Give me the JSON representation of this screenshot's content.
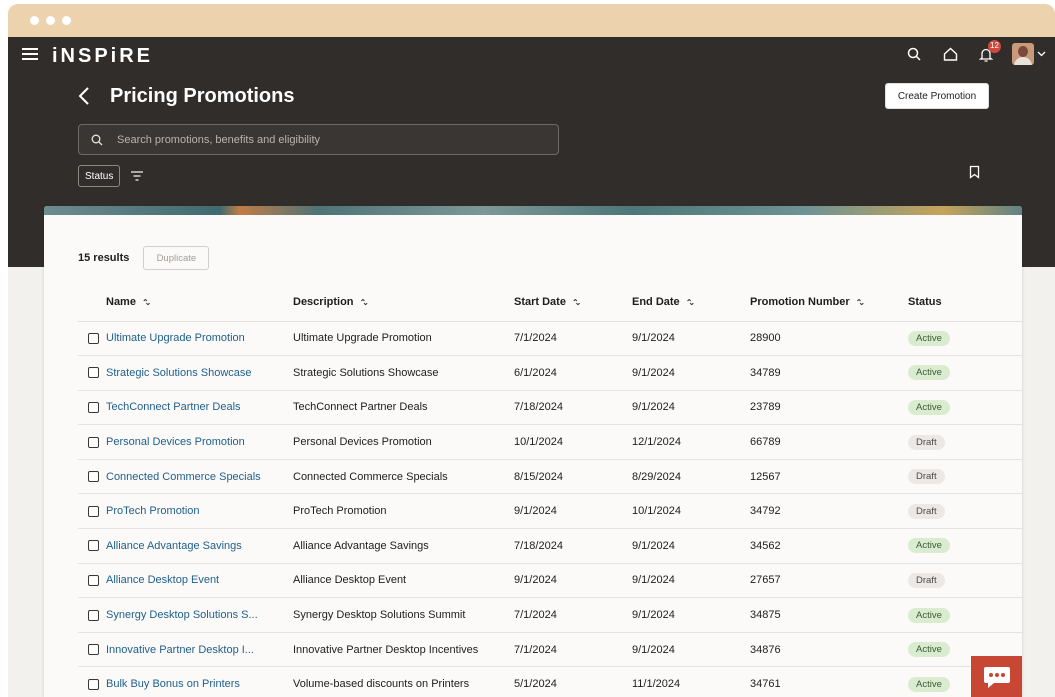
{
  "app": {
    "logo": "iNSPiRE",
    "notification_count": "12"
  },
  "page": {
    "title": "Pricing Promotions",
    "create_button": "Create Promotion",
    "search_placeholder": "Search promotions, benefits and eligibility",
    "filter_chip": "Status"
  },
  "results": {
    "count_label": "15 results",
    "duplicate_button": "Duplicate"
  },
  "table": {
    "columns": [
      "Name",
      "Description",
      "Start Date",
      "End Date",
      "Promotion Number",
      "Status"
    ],
    "rows": [
      {
        "name": "Ultimate Upgrade Promotion",
        "description": "Ultimate Upgrade Promotion",
        "start": "7/1/2024",
        "end": "9/1/2024",
        "number": "28900",
        "status": "Active"
      },
      {
        "name": "Strategic Solutions Showcase",
        "description": "Strategic Solutions Showcase",
        "start": "6/1/2024",
        "end": "9/1/2024",
        "number": "34789",
        "status": "Active"
      },
      {
        "name": "TechConnect Partner Deals",
        "description": "TechConnect Partner Deals",
        "start": "7/18/2024",
        "end": "9/1/2024",
        "number": "23789",
        "status": "Active"
      },
      {
        "name": "Personal Devices Promotion",
        "description": "Personal Devices Promotion",
        "start": "10/1/2024",
        "end": "12/1/2024",
        "number": "66789",
        "status": "Draft"
      },
      {
        "name": "Connected Commerce Specials",
        "description": "Connected Commerce Specials",
        "start": "8/15/2024",
        "end": "8/29/2024",
        "number": "12567",
        "status": "Draft"
      },
      {
        "name": "ProTech Promotion",
        "description": "ProTech Promotion",
        "start": "9/1/2024",
        "end": "10/1/2024",
        "number": "34792",
        "status": "Draft"
      },
      {
        "name": "Alliance Advantage Savings",
        "description": "Alliance Advantage Savings",
        "start": "7/18/2024",
        "end": "9/1/2024",
        "number": "34562",
        "status": "Active"
      },
      {
        "name": "Alliance Desktop Event",
        "description": "Alliance Desktop Event",
        "start": "9/1/2024",
        "end": "9/1/2024",
        "number": "27657",
        "status": "Draft"
      },
      {
        "name": "Synergy Desktop Solutions S...",
        "description": "Synergy Desktop Solutions Summit",
        "start": "7/1/2024",
        "end": "9/1/2024",
        "number": "34875",
        "status": "Active"
      },
      {
        "name": "Innovative Partner Desktop I...",
        "description": "Innovative Partner Desktop Incentives",
        "start": "7/1/2024",
        "end": "9/1/2024",
        "number": "34876",
        "status": "Active"
      },
      {
        "name": "Bulk Buy Bonus on Printers",
        "description": "Volume-based discounts on Printers",
        "start": "5/1/2024",
        "end": "11/1/2024",
        "number": "34761",
        "status": "Active"
      }
    ]
  },
  "icons": {
    "menu": "hamburger-icon",
    "search": "search-icon",
    "home": "home-icon",
    "notifications": "bell-icon",
    "back": "chevron-left-icon",
    "filter": "filter-icon",
    "bookmark": "bookmark-icon",
    "sort": "sort-icon",
    "chat": "chat-icon"
  },
  "colors": {
    "header_bg": "#312d2a",
    "titlebar": "#ecd2ad",
    "link": "#1f5f8b",
    "active_pill": "#d9ecd0",
    "draft_pill": "#ebe8e5",
    "chat_button": "#c74634"
  }
}
